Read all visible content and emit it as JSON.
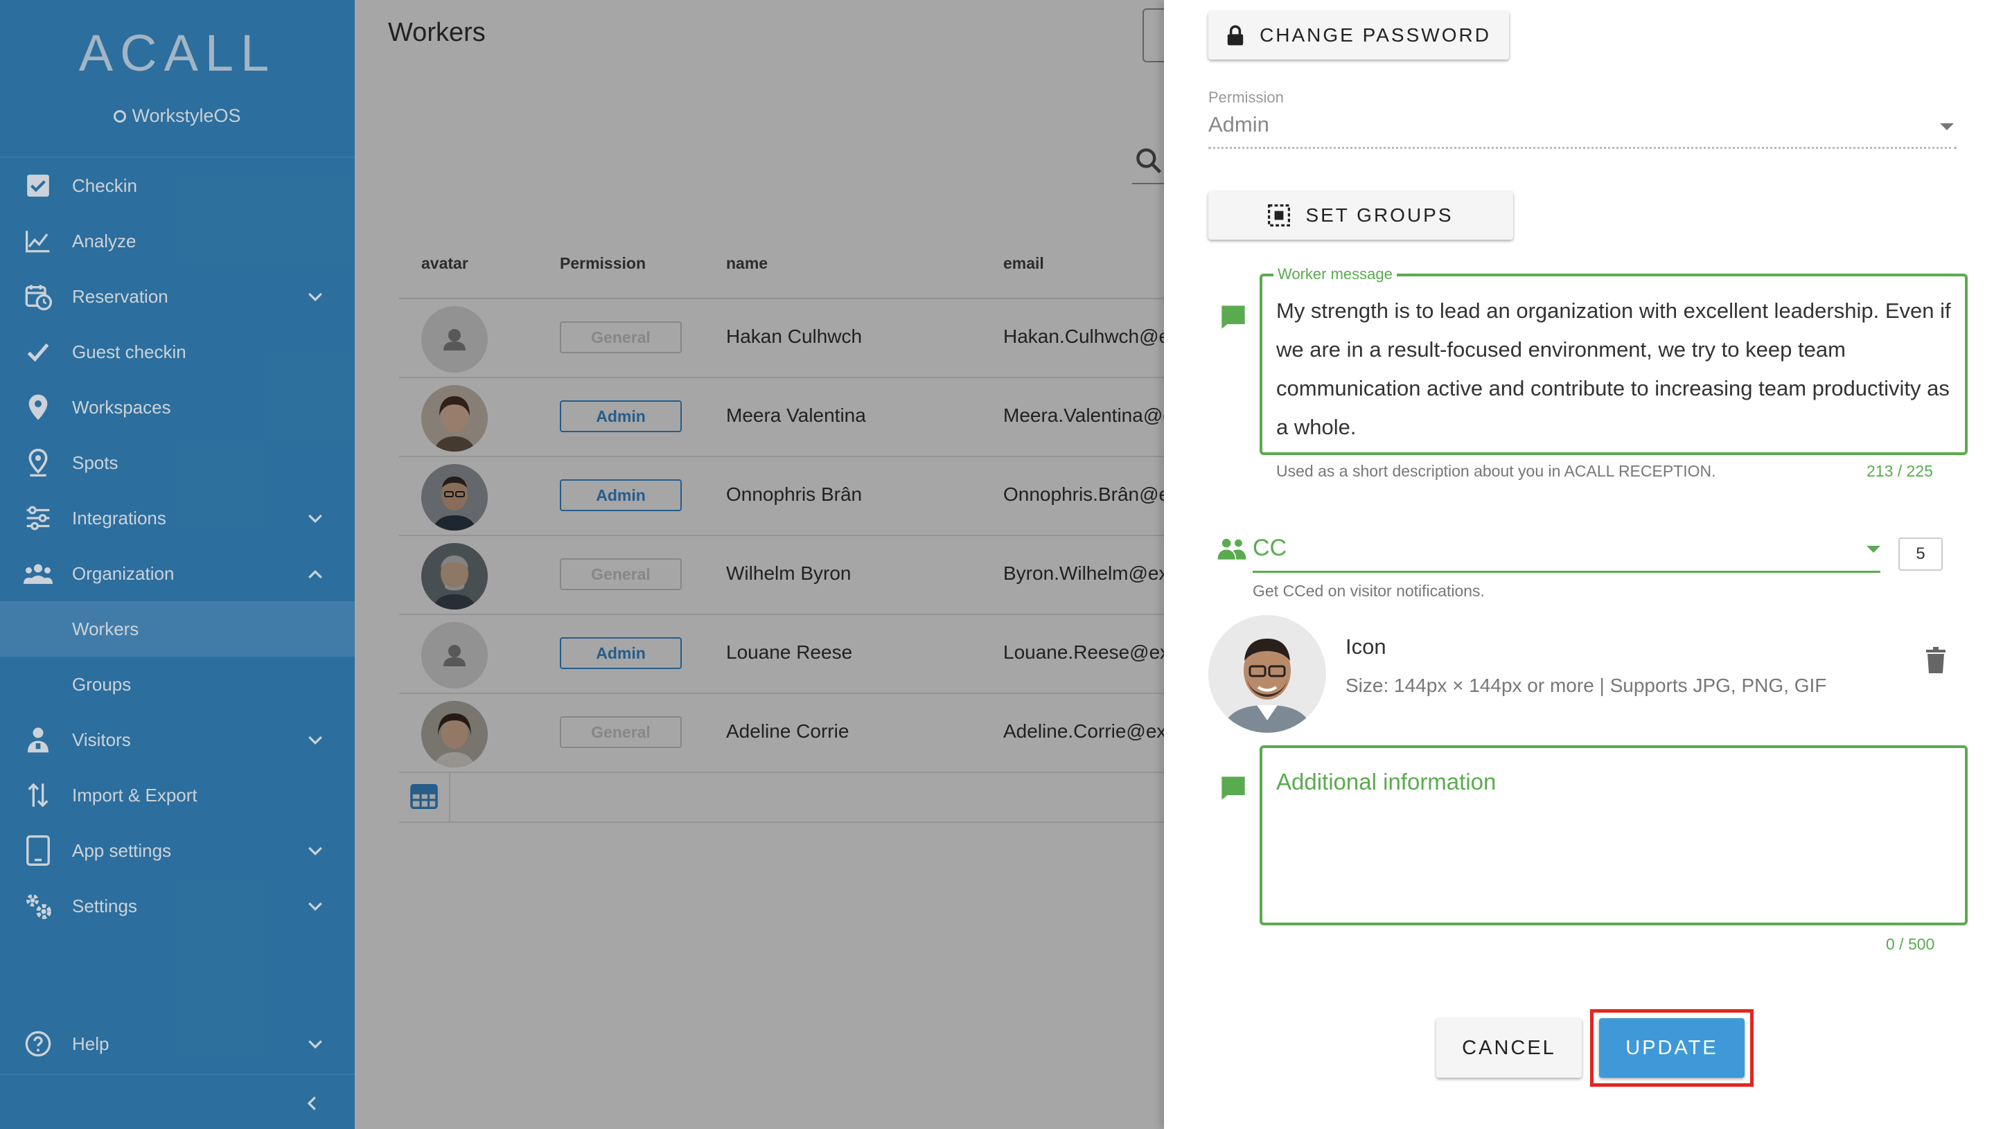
{
  "sidebar": {
    "logo": "ACALL",
    "sublogo": "WorkstyleOS",
    "items": [
      {
        "label": "Checkin"
      },
      {
        "label": "Analyze"
      },
      {
        "label": "Reservation"
      },
      {
        "label": "Guest checkin"
      },
      {
        "label": "Workspaces"
      },
      {
        "label": "Spots"
      },
      {
        "label": "Integrations"
      },
      {
        "label": "Organization"
      },
      {
        "label": "Workers"
      },
      {
        "label": "Groups"
      },
      {
        "label": "Visitors"
      },
      {
        "label": "Import & Export"
      },
      {
        "label": "App settings"
      },
      {
        "label": "Settings"
      },
      {
        "label": "Help"
      }
    ]
  },
  "main": {
    "title": "Workers",
    "columns": [
      "avatar",
      "Permission",
      "name",
      "email"
    ],
    "rows": [
      {
        "permission": "General",
        "name": "Hakan Culhwch",
        "email": "Hakan.Culhwch@e"
      },
      {
        "permission": "Admin",
        "name": "Meera Valentina",
        "email": "Meera.Valentina@e"
      },
      {
        "permission": "Admin",
        "name": "Onnophris Brân",
        "email": "Onnophris.Brân@e"
      },
      {
        "permission": "General",
        "name": "Wilhelm Byron",
        "email": "Byron.Wilhelm@ex"
      },
      {
        "permission": "Admin",
        "name": "Louane Reese",
        "email": "Louane.Reese@ex"
      },
      {
        "permission": "General",
        "name": "Adeline Corrie",
        "email": "Adeline.Corrie@ex"
      }
    ]
  },
  "drawer": {
    "change_password": "CHANGE PASSWORD",
    "permission_label": "Permission",
    "permission_value": "Admin",
    "set_groups": "SET GROUPS",
    "worker_message_label": "Worker message",
    "worker_message": "My strength is to lead an organization with excellent leadership. Even if we are in a result-focused environment, we try to keep team communication active and contribute to increasing team productivity as a whole.",
    "worker_message_hint": "Used as a short description about you in ACALL RECEPTION.",
    "worker_message_counter": "213 / 225",
    "cc_label": "CC",
    "cc_count": "5",
    "cc_hint": "Get CCed on visitor notifications.",
    "icon_title": "Icon",
    "icon_hint": "Size: 144px × 144px or more | Supports JPG, PNG, GIF",
    "additional_placeholder": "Additional information",
    "additional_counter": "0 / 500",
    "cancel": "CANCEL",
    "update": "UPDATE"
  },
  "colors": {
    "sidebar": "#337eb3",
    "accent_green": "#5aab4f",
    "update_button": "#3f99d9",
    "highlight_frame": "#e2261c",
    "admin_badge": "#3b8fd6"
  }
}
